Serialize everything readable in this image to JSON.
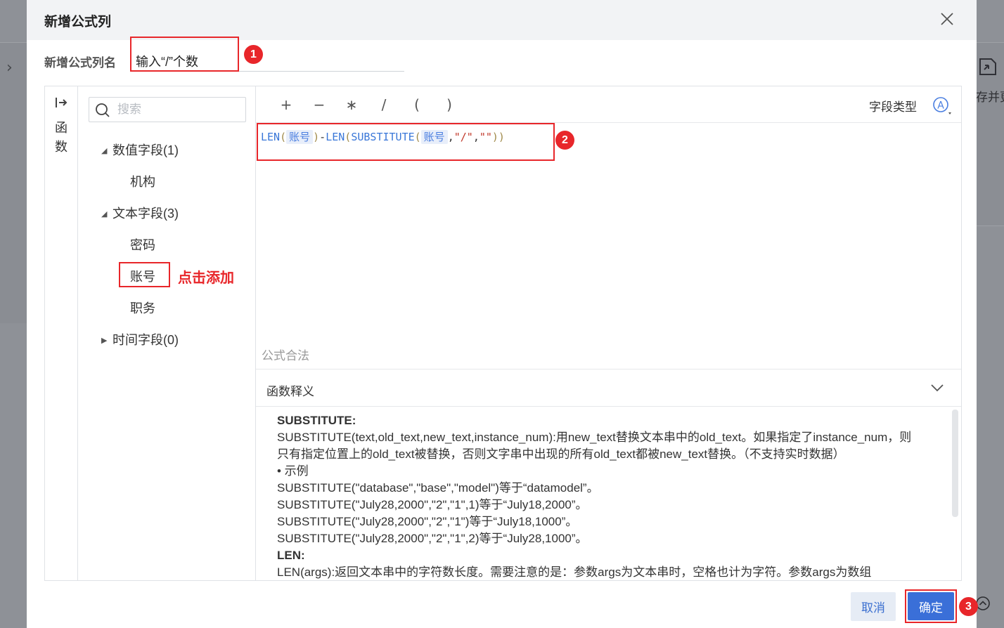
{
  "background": {
    "right_text": "存并更",
    "left_chevron": "›"
  },
  "dialog": {
    "title": "新增公式列",
    "name_label": "新增公式列名",
    "name_value": "输入“/”个数",
    "badges": [
      "1",
      "2",
      "3"
    ],
    "rail_label": "函数",
    "search_placeholder": "搜索",
    "tree": {
      "numeric_group": "数值字段(1)",
      "numeric_items": [
        "机构"
      ],
      "text_group": "文本字段(3)",
      "text_items": [
        "密码",
        "账号",
        "职务"
      ],
      "time_group": "时间字段(0)"
    },
    "click_note": "点击添加",
    "operators": [
      "+",
      "−",
      "∗",
      "/",
      "(",
      ")"
    ],
    "field_type_label": "字段类型",
    "formula": {
      "fn1": "LEN",
      "field1": "账号",
      "minus": "-",
      "fn2": "LEN",
      "fn3": "SUBSTITUTE",
      "field2": "账号",
      "str1": "\"/\"",
      "str2": "\"\""
    },
    "valid_label": "公式合法",
    "explain_title": "函数释义",
    "explain_lines": [
      "SUBSTITUTE:",
      "SUBSTITUTE(text,old_text,new_text,instance_num):用new_text替换文本串中的old_text。如果指定了instance_num，则只有指定位置上的old_text被替换，否则文字串中出现的所有old_text都被new_text替换。（不支持实时数据）",
      "• 示例",
      "SUBSTITUTE(\"database\",\"base\",\"model\")等于“datamodel”。",
      "SUBSTITUTE(\"July28,2000\",\"2\",\"1\",1)等于“July18,2000”。",
      "SUBSTITUTE(\"July28,2000\",\"2\",\"1\")等于“July18,1000”。",
      "SUBSTITUTE(\"July28,2000\",\"2\",\"1\",2)等于“July28,1000”。",
      "LEN:",
      "LEN(args):返回文本串中的字符数长度。需要注意的是：参数args为文本串时，空格也计为字符。参数args为数组"
    ],
    "cancel_label": "取消",
    "ok_label": "确定"
  },
  "colors": {
    "accent": "#3a6fd8",
    "annotation_red": "#e8262a",
    "header_bg": "#f2f3f5"
  }
}
